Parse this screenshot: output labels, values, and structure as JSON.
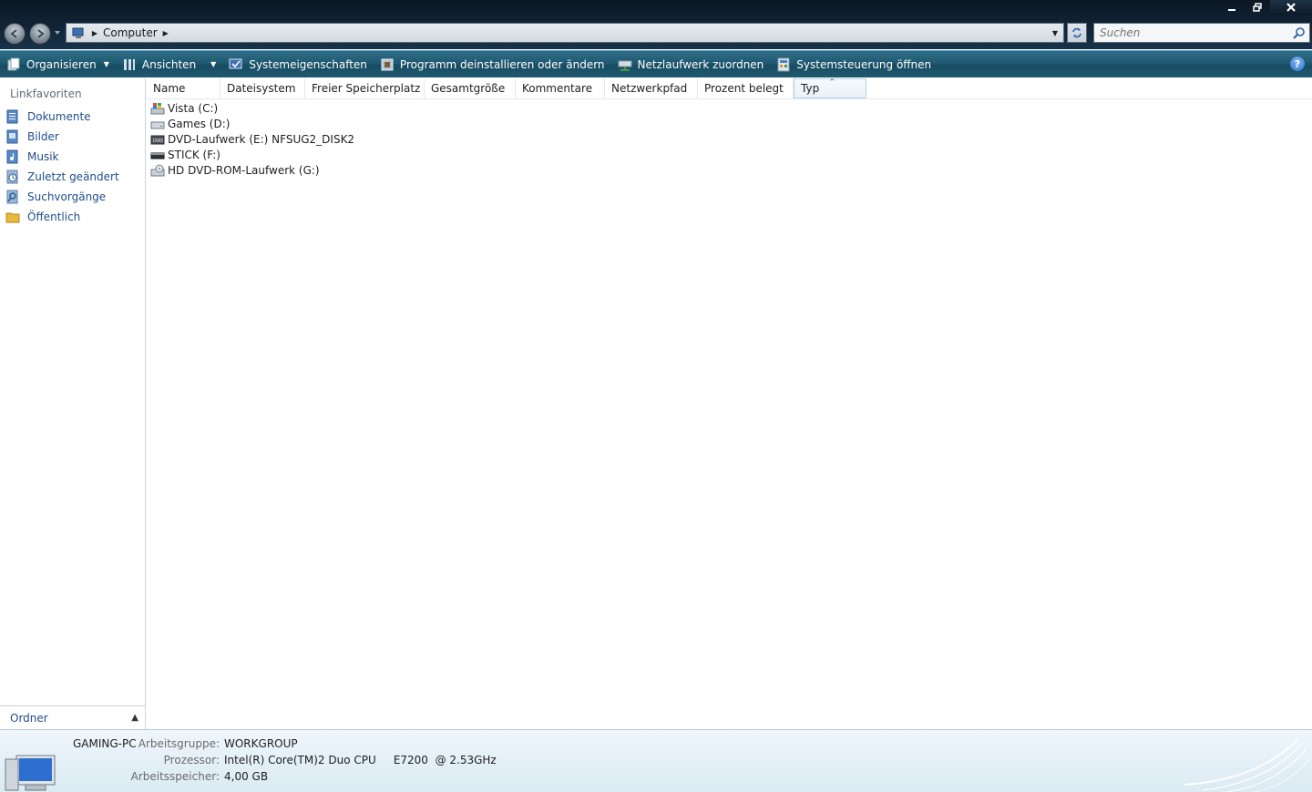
{
  "address": {
    "location": "Computer"
  },
  "search": {
    "placeholder": "Suchen"
  },
  "toolbar": {
    "organize": "Organisieren",
    "views": "Ansichten",
    "system_properties": "Systemeigenschaften",
    "uninstall": "Programm deinstallieren oder ändern",
    "map_drive": "Netzlaufwerk zuordnen",
    "control_panel": "Systemsteuerung öffnen"
  },
  "sidebar": {
    "heading": "Linkfavoriten",
    "items": [
      {
        "label": "Dokumente",
        "icon": "documents-icon"
      },
      {
        "label": "Bilder",
        "icon": "pictures-icon"
      },
      {
        "label": "Musik",
        "icon": "music-icon"
      },
      {
        "label": "Zuletzt geändert",
        "icon": "recent-icon"
      },
      {
        "label": "Suchvorgänge",
        "icon": "searches-icon"
      },
      {
        "label": "Öffentlich",
        "icon": "public-folder-icon"
      }
    ],
    "folders_label": "Ordner"
  },
  "columns": [
    "Name",
    "Dateisystem",
    "Freier Speicherplatz",
    "Gesamtgröße",
    "Kommentare",
    "Netzwerkpfad",
    "Prozent belegt",
    "Typ"
  ],
  "drives": [
    {
      "name": "Vista (C:)",
      "icon": "vista-drive-icon"
    },
    {
      "name": "Games (D:)",
      "icon": "hard-drive-icon"
    },
    {
      "name": "DVD-Laufwerk (E:) NFSUG2_DISK2",
      "icon": "dvd-drive-icon"
    },
    {
      "name": "STICK (F:)",
      "icon": "removable-drive-icon"
    },
    {
      "name": "HD DVD-ROM-Laufwerk (G:)",
      "icon": "hd-dvd-drive-icon"
    }
  ],
  "details": {
    "computer_name": "GAMING-PC",
    "workgroup_label": "Arbeitsgruppe:",
    "workgroup": "WORKGROUP",
    "processor_label": "Prozessor:",
    "processor": "Intel(R) Core(TM)2 Duo CPU     E7200  @ 2.53GHz",
    "memory_label": "Arbeitsspeicher:",
    "memory": "4,00 GB"
  }
}
